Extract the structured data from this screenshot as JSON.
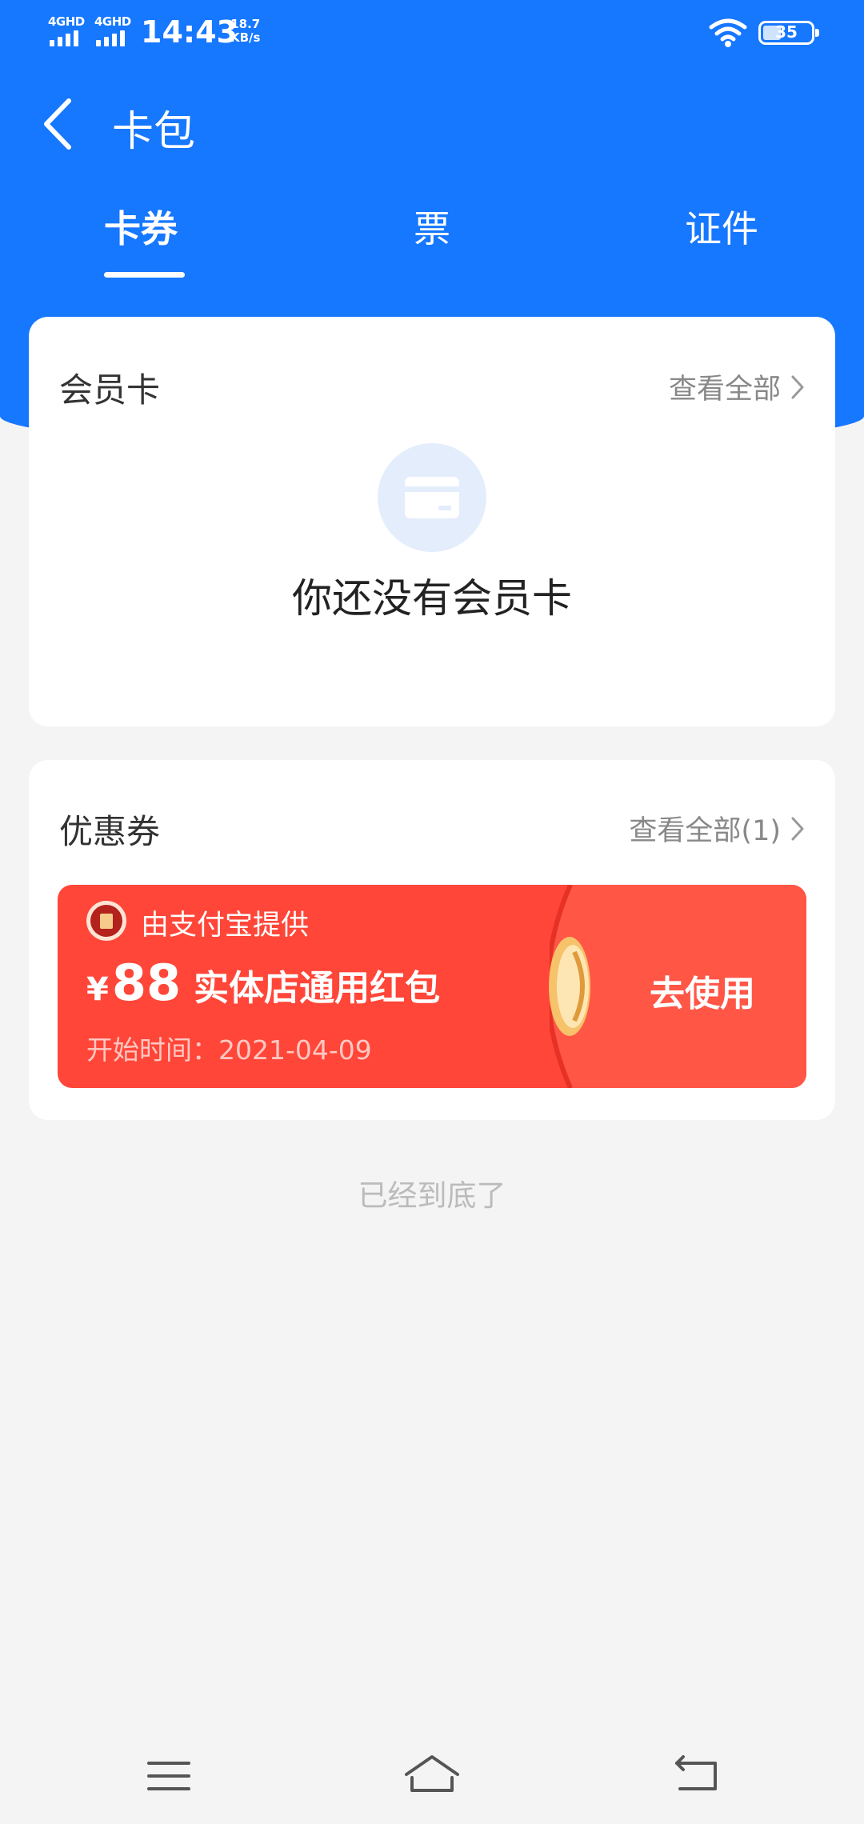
{
  "status_bar": {
    "signal1_tag": "4GHD",
    "signal2_tag": "4GHD",
    "time": "14:43",
    "net_speed_value": "18.7",
    "net_speed_unit": "KB/s",
    "battery_level": "35",
    "icons": [
      "signal-icon",
      "wifi-icon",
      "battery-icon"
    ]
  },
  "header": {
    "title": "卡包",
    "back_icon": "chevron-left-icon",
    "background_color": "#1677ff"
  },
  "tabs": [
    {
      "label": "卡券",
      "active": true
    },
    {
      "label": "票",
      "active": false
    },
    {
      "label": "证件",
      "active": false
    }
  ],
  "member_card": {
    "title": "会员卡",
    "view_all": "查看全部",
    "empty_icon": "card-icon",
    "empty_text": "你还没有会员卡"
  },
  "coupons": {
    "title": "优惠券",
    "view_all": "查看全部(1)",
    "item": {
      "provider": "由支付宝提供",
      "provider_icon": "red-packet-icon",
      "currency": "¥",
      "amount": "88",
      "name": "实体店通用红包",
      "start_date": "开始时间：2021-04-09",
      "action": "去使用",
      "color": "#ff4638"
    }
  },
  "footer_hint": "已经到底了",
  "nav_bar": {
    "icons": [
      "menu-icon",
      "home-icon",
      "back-icon"
    ]
  }
}
